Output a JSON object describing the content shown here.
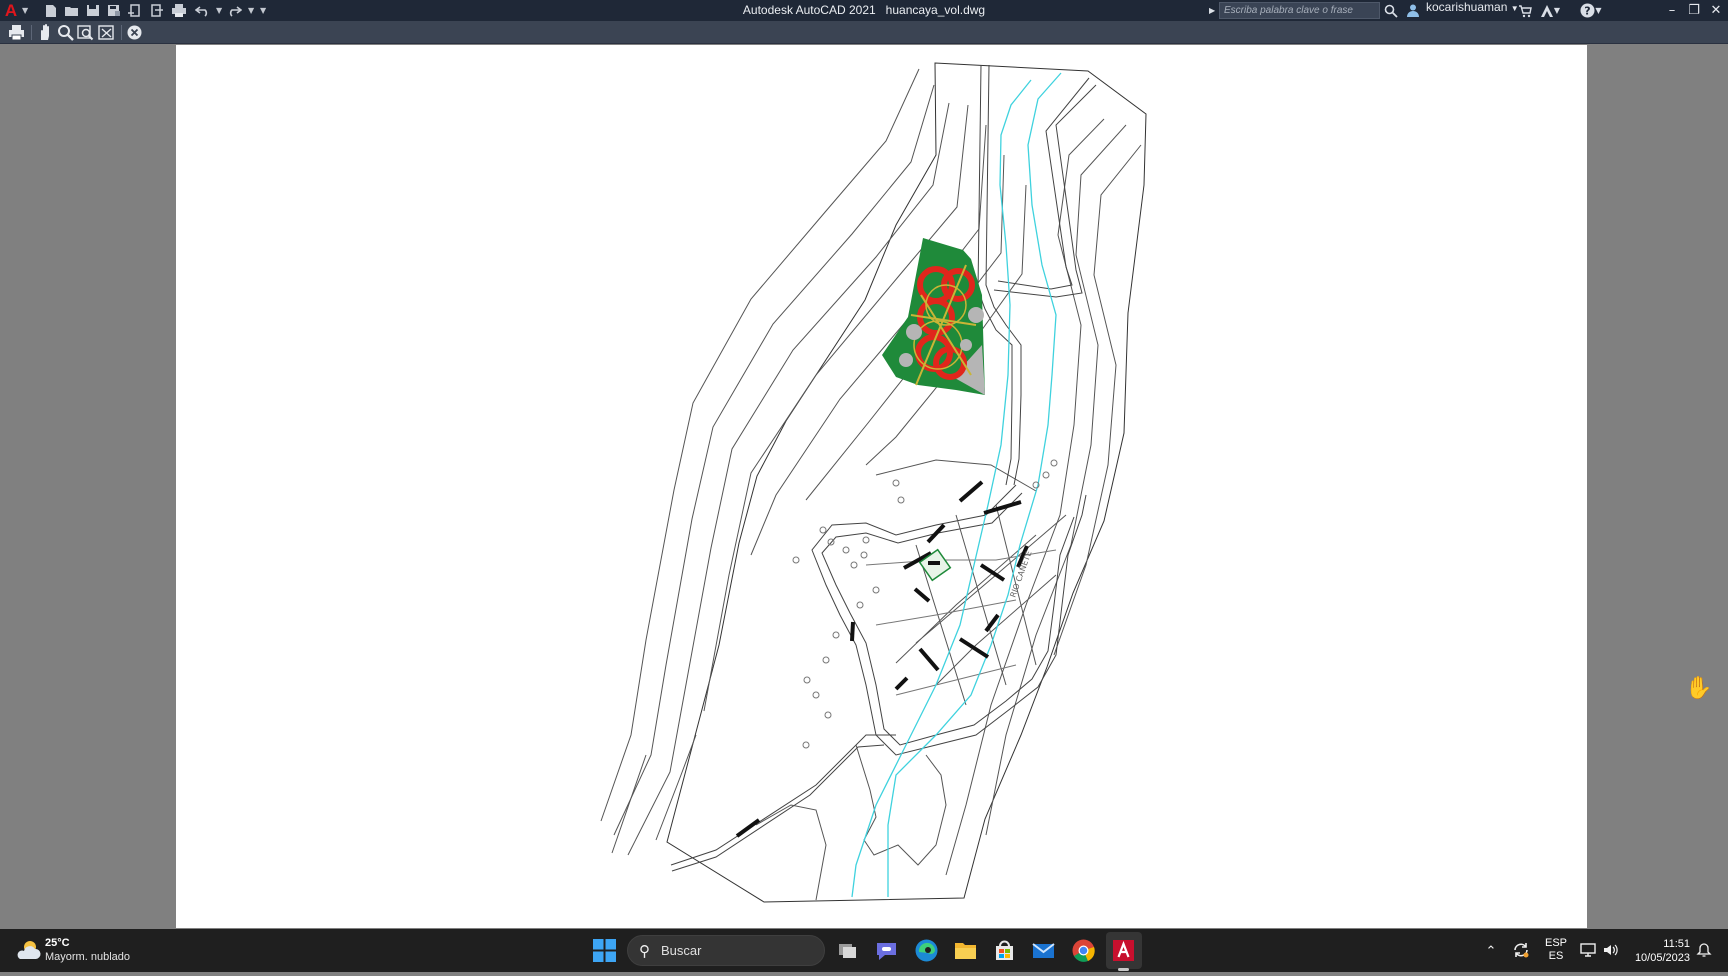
{
  "titlebar": {
    "app_icon": "autocad-a-logo",
    "app_name": "Autodesk AutoCAD 2021",
    "file_name": "huancaya_vol.dwg",
    "search_placeholder": "Escriba palabra clave o frase",
    "username": "kocarishuaman",
    "quick_access": [
      "new-icon",
      "open-icon",
      "save-icon",
      "save-as-icon",
      "import-icon",
      "export-icon",
      "plot-icon",
      "undo-icon",
      "redo-icon",
      "customize-icon"
    ],
    "window_controls": [
      "minimize-icon",
      "restore-icon",
      "close-icon"
    ]
  },
  "preview_toolbar": {
    "buttons": [
      "plot-icon",
      "pan-icon",
      "zoom-icon",
      "zoom-window-icon",
      "zoom-original-icon",
      "close-preview-icon"
    ]
  },
  "drawing": {
    "river_label": "RIO CAÑETE",
    "colors": {
      "contour": "#555555",
      "river": "#3fd2de",
      "park_green": "#1f8a3a",
      "park_red": "#e0261c",
      "park_yellow": "#c9b536",
      "park_gray": "#b5b5b5"
    }
  },
  "taskbar": {
    "weather_temp": "25°C",
    "weather_desc": "Mayorm. nublado",
    "search_label": "Buscar",
    "apps": [
      "task-view-icon",
      "teams-chat-icon",
      "edge-icon",
      "file-explorer-icon",
      "microsoft-store-icon",
      "mail-icon",
      "chrome-icon",
      "autocad-icon"
    ],
    "active_app": "autocad-icon",
    "lang_line1": "ESP",
    "lang_line2": "ES",
    "time": "11:51",
    "date": "10/05/2023"
  }
}
